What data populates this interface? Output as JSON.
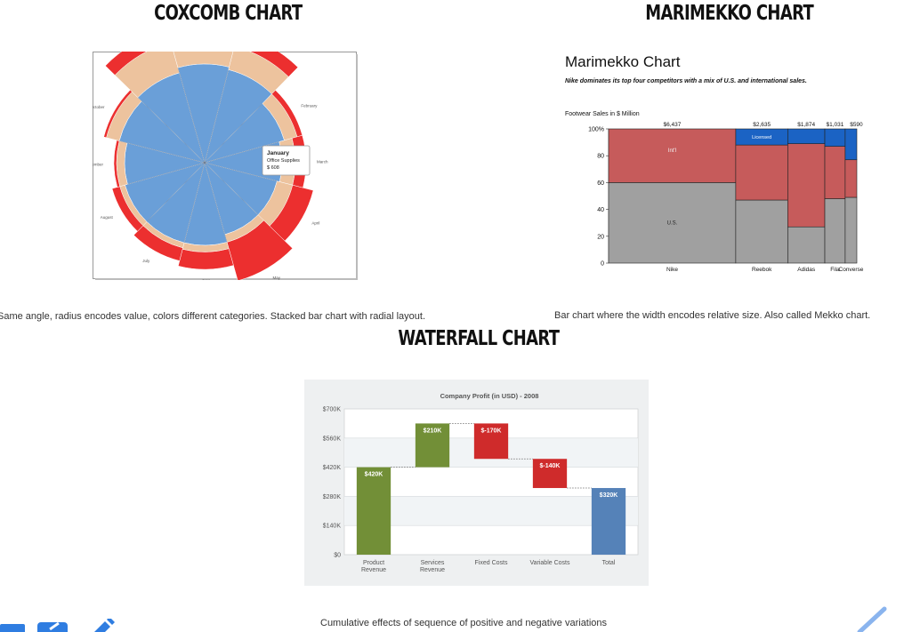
{
  "sections": {
    "coxcomb": {
      "heading": "COXCOMB CHART",
      "caption": "Same angle, radius encodes value, colors different categories. Stacked bar chart with radial layout."
    },
    "marimekko": {
      "heading": "MARIMEKKO CHART",
      "caption": "Bar chart where the width encodes relative size. Also called Mekko chart."
    },
    "waterfall": {
      "heading": "WATERFALL CHART",
      "caption": "Cumulative effects of sequence of positive and negative variations"
    }
  },
  "chart_data": [
    {
      "type": "coxcomb",
      "categories": [
        "January",
        "February",
        "March",
        "April",
        "May",
        "June",
        "July",
        "August",
        "September",
        "October",
        "November",
        "December"
      ],
      "series_colors": [
        "#6a9fd8",
        "#edc39e",
        "#ec2f2f"
      ],
      "stack_values": [
        [
          0.72,
          0.18,
          0.1
        ],
        [
          0.62,
          0.1,
          0.04
        ],
        [
          0.58,
          0.1,
          0.08
        ],
        [
          0.56,
          0.12,
          0.16
        ],
        [
          0.56,
          0.06,
          0.3
        ],
        [
          0.62,
          0.05,
          0.13
        ],
        [
          0.62,
          0.04,
          0.1
        ],
        [
          0.62,
          0.04,
          0.06
        ],
        [
          0.6,
          0.06,
          0.02
        ],
        [
          0.66,
          0.1,
          0.02
        ],
        [
          0.7,
          0.24,
          0.1
        ],
        [
          0.74,
          0.18,
          0.06
        ]
      ],
      "max_value": 1.0,
      "tooltip": {
        "title": "January",
        "series": "Office Supplies",
        "value": "$ 608"
      }
    },
    {
      "type": "marimekko",
      "title": "Marimekko Chart",
      "subtitle": "Nike dominates its top four competitors with a mix of U.S. and international sales.",
      "axis_title": "Footwear Sales in $ Million",
      "y_ticks": [
        "100%",
        "80",
        "60",
        "40",
        "20",
        "0"
      ],
      "categories": [
        {
          "name": "Nike",
          "total": 6437,
          "total_label": "$6,437",
          "us": 60,
          "intl": 40,
          "licensed": 0
        },
        {
          "name": "Reebok",
          "total": 2635,
          "total_label": "$2,635",
          "us": 47,
          "intl": 41,
          "licensed": 12
        },
        {
          "name": "Adidas",
          "total": 1874,
          "total_label": "$1,874",
          "us": 27,
          "intl": 62,
          "licensed": 11
        },
        {
          "name": "Fila",
          "total": 1031,
          "total_label": "$1,031",
          "us": 48,
          "intl": 39,
          "licensed": 13
        },
        {
          "name": "Converse",
          "total": 590,
          "total_label": "$590",
          "us": 49,
          "intl": 28,
          "licensed": 23
        }
      ],
      "segment_labels": {
        "us": "U.S.",
        "intl": "Int'l",
        "licensed": "Licensed"
      },
      "colors": {
        "us": "#a0a0a0",
        "intl": "#c65b5b",
        "licensed": "#1b63c4"
      }
    },
    {
      "type": "waterfall",
      "title": "Company Profit (in USD) - 2008",
      "y_ticks": [
        "$700K",
        "$560K",
        "$420K",
        "$280K",
        "$140K",
        "$0"
      ],
      "ylim": [
        0,
        700
      ],
      "steps": [
        {
          "label": [
            "Product",
            "Revenue"
          ],
          "start": 0,
          "end": 420,
          "value_label": "$420K",
          "color": "#728f37"
        },
        {
          "label": [
            "Services",
            "Revenue"
          ],
          "start": 420,
          "end": 630,
          "value_label": "$210K",
          "color": "#728f37"
        },
        {
          "label": [
            "Fixed Costs"
          ],
          "start": 630,
          "end": 460,
          "value_label": "$-170K",
          "color": "#cf2b2b"
        },
        {
          "label": [
            "Variable Costs"
          ],
          "start": 460,
          "end": 320,
          "value_label": "$-140K",
          "color": "#cf2b2b"
        },
        {
          "label": [
            "Total"
          ],
          "start": 0,
          "end": 320,
          "value_label": "$320K",
          "color": "#5582b8"
        }
      ]
    }
  ],
  "icons": {
    "bottom_left": [
      "dash-icon",
      "edit-square-icon",
      "pencil-icon"
    ],
    "bottom_right": [
      "diagonal-line-icon"
    ]
  }
}
